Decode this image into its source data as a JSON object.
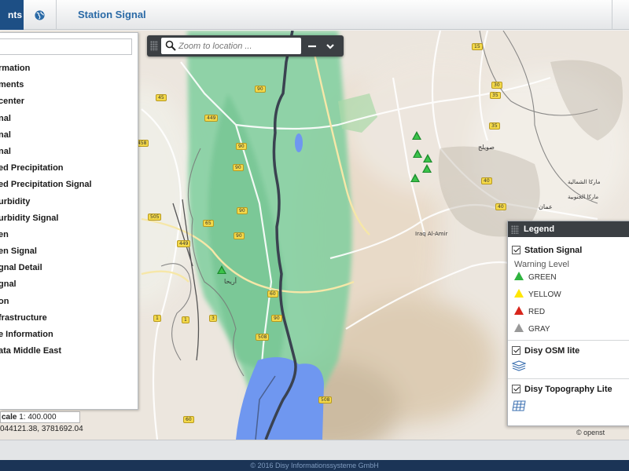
{
  "topbar": {
    "active_tab_label": "nts",
    "title": "Station Signal"
  },
  "layer_panel": {
    "filter_placeholder": "",
    "items": [
      "rmation",
      "ments",
      "center",
      "nal",
      "nal",
      "nal",
      "ed Precipitation",
      "ed Precipitation Signal",
      "urbidity",
      "urbidity Signal",
      "en",
      "en Signal",
      "gnal Detail",
      "gnal",
      "on",
      "frastructure",
      "e Information",
      "ata Middle East"
    ]
  },
  "map": {
    "scale_label": "cale",
    "scale_value": "1: 400.000",
    "coordinates": "044121.38, 3781692.04",
    "search_placeholder": "Zoom to location ...",
    "attribution": "© openst",
    "labels": {
      "place_1": "أريحا",
      "place_2": "Iraq Al-Amir",
      "place_3": "عمان",
      "place_4": "صويلح",
      "place_5": "ماركا الشمالية",
      "place_6": "ماركا الجنوبية"
    },
    "road_shields": [
      "90",
      "90",
      "90",
      "90",
      "90",
      "449",
      "458",
      "1",
      "3",
      "1",
      "65",
      "35",
      "35",
      "40",
      "40",
      "30",
      "15",
      "508",
      "505",
      "60",
      "45",
      "449",
      "508",
      "90",
      "60"
    ]
  },
  "legend": {
    "title": "Legend",
    "groups": [
      {
        "title": "Station Signal",
        "subtitle": "Warning Level",
        "items": [
          {
            "label": "GREEN",
            "color": "#2fb33f"
          },
          {
            "label": "YELLOW",
            "color": "#ffe600"
          },
          {
            "label": "RED",
            "color": "#d8261c"
          },
          {
            "label": "GRAY",
            "color": "#999999"
          }
        ]
      },
      {
        "title": "Disy OSM lite"
      },
      {
        "title": "Disy Topography Lite"
      }
    ]
  },
  "footer": {
    "copyright": "© 2016 Disy Informationssysteme GmbH"
  },
  "colors": {
    "accent": "#1d4f85",
    "title": "#2a6aa6",
    "green_zone": "#7ed3a0",
    "lake": "#6f97f0",
    "toolbar": "#3b3f43",
    "footer": "#1b3456"
  }
}
